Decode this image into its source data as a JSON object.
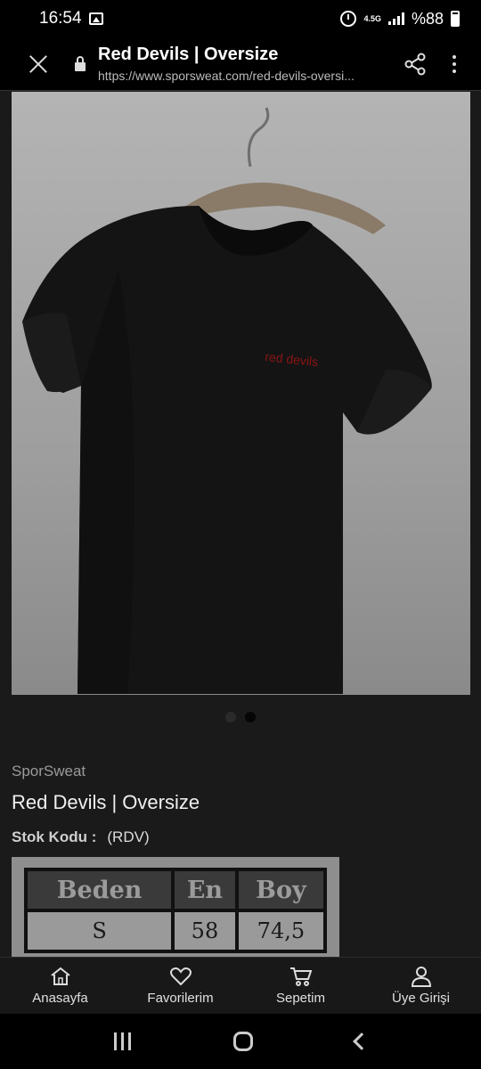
{
  "status_bar": {
    "time": "16:54",
    "network": "4.5G",
    "battery": "%88",
    "icons": [
      "image-icon",
      "alarm-icon",
      "signal-icon",
      "battery-icon"
    ]
  },
  "browser": {
    "title": "Red Devils | Oversize",
    "url": "https://www.sporsweat.com/red-devils-oversi...",
    "icons": [
      "close-icon",
      "lock-icon",
      "share-icon",
      "more-vert-icon"
    ]
  },
  "product": {
    "image_text": "red devils",
    "gallery_total": 2,
    "gallery_active": 2,
    "brand": "SporSweat",
    "name": "Red Devils | Oversize",
    "stock_label": "Stok Kodu :",
    "stock_value": "(RDV)"
  },
  "size_table": {
    "headers": [
      "Beden",
      "En",
      "Boy"
    ],
    "rows": [
      [
        "S",
        "58",
        "74,5"
      ]
    ]
  },
  "bottom_nav": [
    {
      "label": "Anasayfa",
      "icon": "home-icon"
    },
    {
      "label": "Favorilerim",
      "icon": "heart-icon"
    },
    {
      "label": "Sepetim",
      "icon": "cart-icon"
    },
    {
      "label": "Üye Girişi",
      "icon": "user-icon"
    }
  ],
  "colors": {
    "accent_print": "#8b1414",
    "background": "#1a1a1a"
  }
}
